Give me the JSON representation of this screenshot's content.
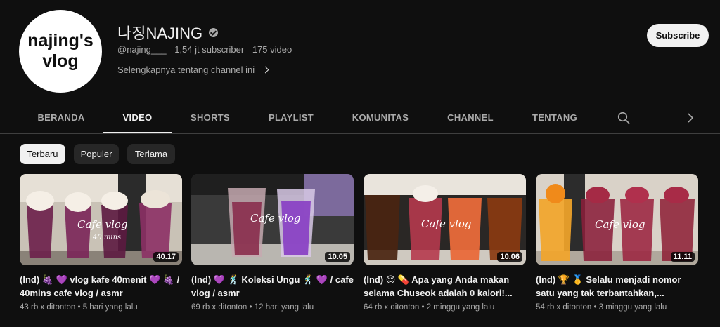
{
  "channel": {
    "avatar_text": "najing's vlog",
    "name": "나징NAJING",
    "handle": "@najing___",
    "subscribers": "1,54 jt subscriber",
    "video_count": "175 video",
    "about_link": "Selengkapnya tentang channel ini",
    "subscribe_label": "Subscribe"
  },
  "tabs": [
    "BERANDA",
    "VIDEO",
    "SHORTS",
    "PLAYLIST",
    "KOMUNITAS",
    "CHANNEL",
    "TENTANG"
  ],
  "active_tab": "VIDEO",
  "icons": {
    "search": "search-icon",
    "next": "chevron-right-icon",
    "verified": "verified-check-icon"
  },
  "chips": [
    "Terbaru",
    "Populer",
    "Terlama"
  ],
  "active_chip": "Terbaru",
  "videos": [
    {
      "title": "(Ind) 🍇 💜 vlog kafe 40menit 💜 🍇 / 40mins cafe vlog / asmr",
      "views": "43 rb x ditonton",
      "age": "5 hari yang lalu",
      "duration": "40.17",
      "overlay": "Cafe vlog",
      "overlay_sub": "40 mins"
    },
    {
      "title": "(Ind) 💜 🕺 Koleksi Ungu 🕺 💜 / cafe vlog / asmr",
      "views": "69 rb x ditonton",
      "age": "12 hari yang lalu",
      "duration": "10.05",
      "overlay": "Cafe vlog"
    },
    {
      "title": "(Ind) 😌 💊 Apa yang Anda makan selama Chuseok adalah 0 kalori!...",
      "views": "64 rb x ditonton",
      "age": "2 minggu yang lalu",
      "duration": "10.06",
      "overlay": "Cafe vlog"
    },
    {
      "title": "(Ind) 🏆 🥇 Selalu menjadi nomor satu yang tak terbantahkan,...",
      "views": "54 rb x ditonton",
      "age": "3 minggu yang lalu",
      "duration": "11.11",
      "overlay": "Cafe vlog"
    }
  ],
  "colors": {
    "background": "#0f0f0f",
    "text_primary": "#f1f1f1",
    "text_secondary": "#aaaaaa",
    "chip_bg": "#272727",
    "divider": "#3f3f3f"
  }
}
